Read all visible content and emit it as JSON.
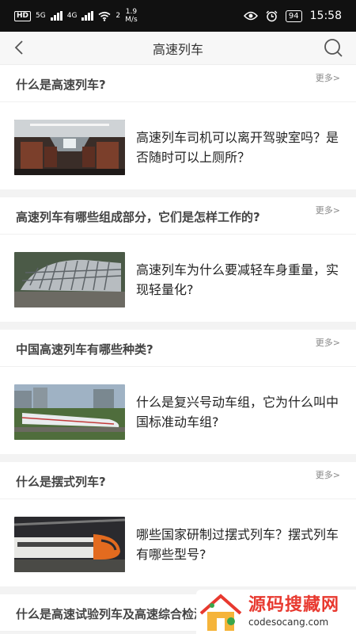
{
  "status_bar": {
    "hd": "HD",
    "signal1": "5G",
    "signal2": "4G",
    "wifi_num": "2",
    "speed": "1.9",
    "speed_unit": "M/s",
    "battery": "94",
    "time": "15:58"
  },
  "header": {
    "title": "高速列车"
  },
  "sections": [
    {
      "title": "什么是高速列车?",
      "more": "更多>",
      "article": "高速列车司机可以离开驾驶室吗？是否随时可以上厕所？"
    },
    {
      "title": "高速列车有哪些组成部分，它们是怎样工作的?",
      "more": "更多>",
      "article": "高速列车为什么要减轻车身重量，实现轻量化?"
    },
    {
      "title": "中国高速列车有哪些种类?",
      "more": "更多>",
      "article": "什么是复兴号动车组，它为什么叫中国标准动车组?"
    },
    {
      "title": "什么是摆式列车?",
      "more": "更多>",
      "article": "哪些国家研制过摆式列车？摆式列车有哪些型号?"
    },
    {
      "title": "什么是高速试验列车及高速综合检测列车?"
    }
  ],
  "watermark": {
    "cn": "源码搜藏网",
    "en": "codesocang.com"
  }
}
